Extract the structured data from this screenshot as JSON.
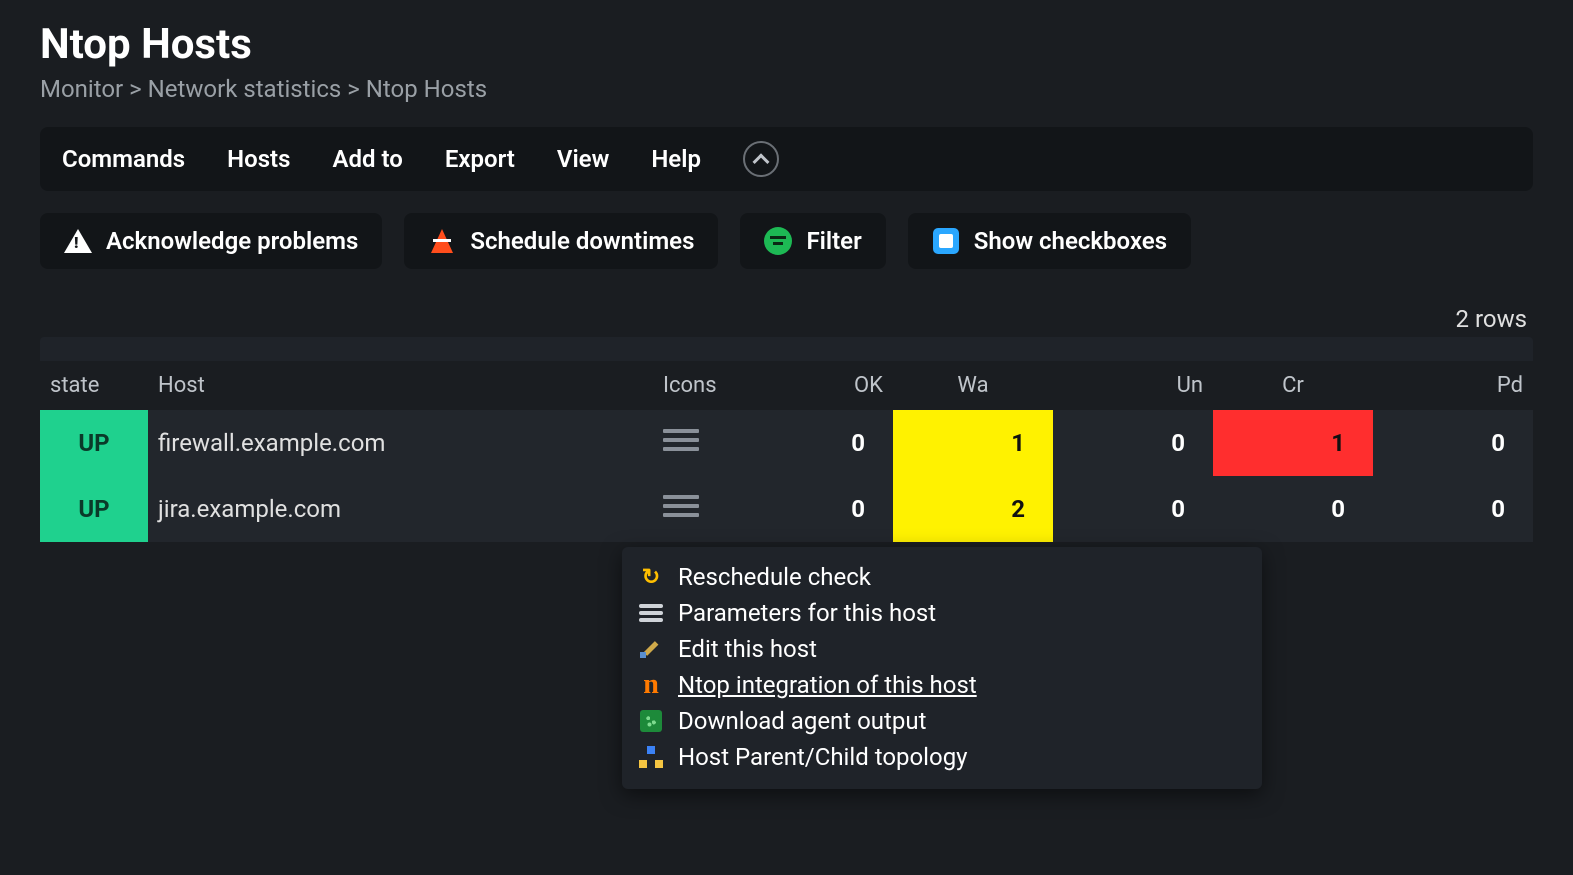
{
  "page": {
    "title": "Ntop Hosts",
    "breadcrumb": [
      "Monitor",
      "Network statistics",
      "Ntop Hosts"
    ]
  },
  "menubar": {
    "items": [
      "Commands",
      "Hosts",
      "Add to",
      "Export",
      "View",
      "Help"
    ]
  },
  "actions": {
    "ack": "Acknowledge problems",
    "schedule": "Schedule downtimes",
    "filter": "Filter",
    "checkboxes": "Show checkboxes"
  },
  "table": {
    "rowcount": "2 rows",
    "headers": {
      "state": "state",
      "host": "Host",
      "icons": "Icons",
      "ok": "OK",
      "wa": "Wa",
      "un": "Un",
      "cr": "Cr",
      "pd": "Pd"
    },
    "rows": [
      {
        "state": "UP",
        "host": "firewall.example.com",
        "ok": "0",
        "wa": "1",
        "un": "0",
        "cr": "1",
        "pd": "0",
        "wa_hl": true,
        "cr_hl": true
      },
      {
        "state": "UP",
        "host": "jira.example.com",
        "ok": "0",
        "wa": "2",
        "un": "0",
        "cr": "0",
        "pd": "0",
        "wa_hl": true,
        "cr_hl": false
      }
    ]
  },
  "context_menu": {
    "items": [
      {
        "icon": "refresh",
        "label": "Reschedule check"
      },
      {
        "icon": "params",
        "label": "Parameters for this host"
      },
      {
        "icon": "edit",
        "label": "Edit this host"
      },
      {
        "icon": "ntop",
        "label": "Ntop integration of this host",
        "highlight": true
      },
      {
        "icon": "download",
        "label": "Download agent output"
      },
      {
        "icon": "topology",
        "label": "Host Parent/Child topology"
      }
    ]
  }
}
